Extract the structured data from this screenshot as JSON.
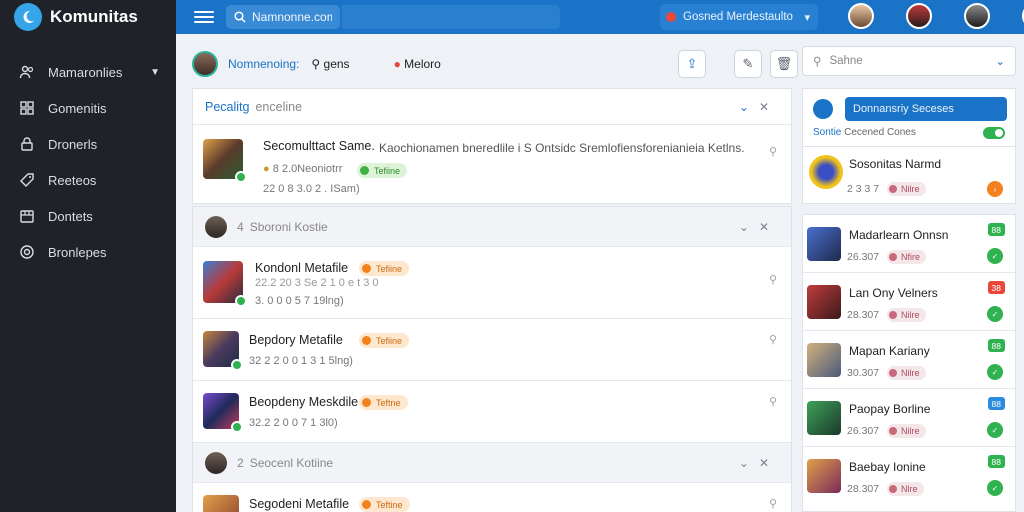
{
  "app": {
    "name": "Komunitas",
    "logo_icon": "moon-icon",
    "accent": "#1a73c7"
  },
  "sidebar": {
    "items": [
      {
        "label": "Mamaronlies",
        "icon": "users-icon",
        "has_chevron": true
      },
      {
        "label": "Gomenitis",
        "icon": "grid-icon"
      },
      {
        "label": "Dronerls",
        "icon": "lock-icon"
      },
      {
        "label": "Reeteos",
        "icon": "tag-icon"
      },
      {
        "label": "Dontets",
        "icon": "box-icon"
      },
      {
        "label": "Bronlepes",
        "icon": "target-icon"
      }
    ]
  },
  "topbar": {
    "search_value": "Namnonne.com",
    "select_label": "Gosned Merdestaulto",
    "select_dot_color": "#e9473c"
  },
  "main": {
    "header": {
      "name": "Nomnenoing:",
      "label1": "gens",
      "label2": "Meloro"
    },
    "featured_card": {
      "title_main": "Pecalitg",
      "title_sub": "enceline",
      "post": {
        "title": "Secomulttact Same.",
        "excerpt": "Kaochionamen bneredlile i S Ontsidc Sremlofiensforenianieia Ketlns.",
        "meta1": "8 2.0Neoniotrr",
        "badge": "Tefiine",
        "meta2": "22 0 8 3.0 2 . ISam)"
      }
    },
    "group1": {
      "title": "Sboroni Kostie",
      "count": "4",
      "posts": [
        {
          "title": "Kondonl Metafile",
          "badge": "Tefiine",
          "meta1": "22.2 20 3 Se 2 1 0 e t 3 0",
          "meta2": "3. 0 0 0 5 7 19lng)"
        },
        {
          "title": "Bepdory Metafile",
          "badge": "Tefiine",
          "meta1": "32 2 2 0 0 1 3 1 5lng)"
        },
        {
          "title": "Beopdeny Meskdile",
          "badge": "Teftne",
          "meta1": "32.2 2 0 0 7 1 3l0)"
        }
      ]
    },
    "group2": {
      "title": "Seocenl Kotiine",
      "count": "2",
      "posts": [
        {
          "title": "Segodeni Metafile",
          "badge": "Teftine"
        }
      ]
    }
  },
  "right": {
    "search_placeholder": "Sahne",
    "promo": {
      "button": "Donnansriy Seceses",
      "label_a": "Sontie",
      "label_b": "Cecened Cones"
    },
    "featured": {
      "name": "Sosonitas Narmd",
      "num": "2",
      "num2": "3 3 7",
      "tag": "Nilre"
    },
    "list": [
      {
        "name": "Madarlearn Onnsn",
        "num": "26.307",
        "tag": "Nfire",
        "badge": "88",
        "badge_color": "#2fb24f",
        "dot_color": "#2fb24f"
      },
      {
        "name": "Lan Ony Velners",
        "num": "28.307",
        "tag": "Nilre",
        "badge": "38",
        "badge_color": "#e9473c",
        "dot_color": "#2fb24f"
      },
      {
        "name": "Mapan Kariany",
        "num": "30.307",
        "tag": "Nilre",
        "badge": "88",
        "badge_color": "#2fb24f",
        "dot_color": "#2fb24f"
      },
      {
        "name": "Paopay Borline",
        "num": "26.307",
        "tag": "Nilre",
        "badge": "88",
        "badge_color": "#2b8be0",
        "dot_color": "#2fb24f"
      },
      {
        "name": "Baebay Ionine",
        "num": "28.307",
        "tag": "Nlre",
        "badge": "88",
        "badge_color": "#2fb24f",
        "dot_color": "#2fb24f"
      }
    ]
  }
}
